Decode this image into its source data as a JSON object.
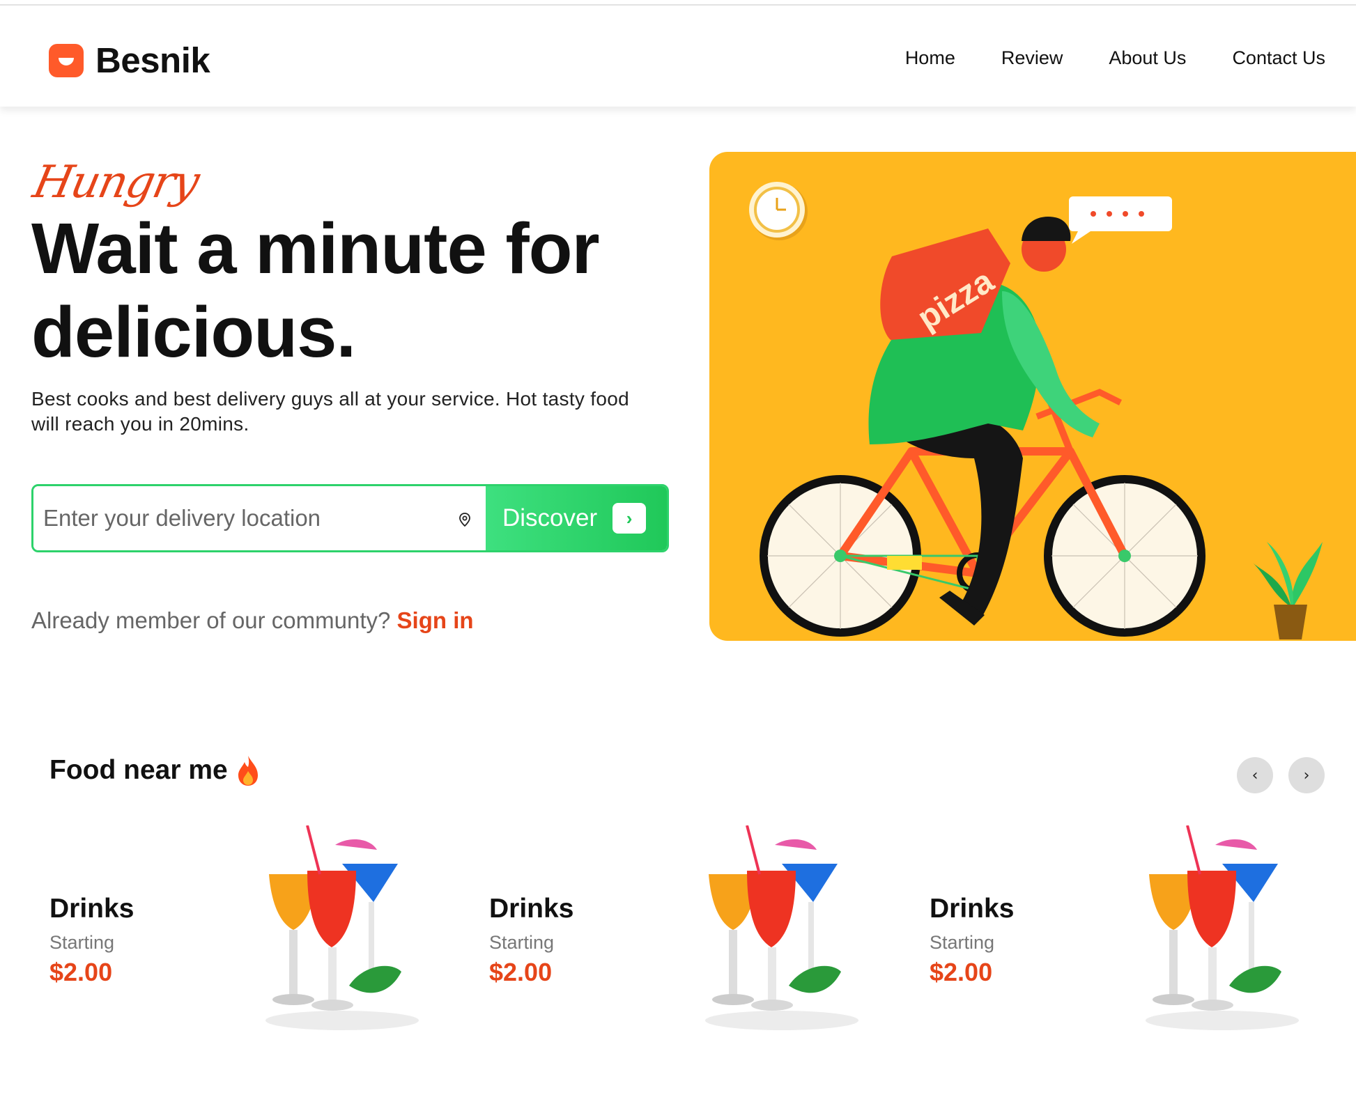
{
  "brand": {
    "name": "Besnik",
    "accent": "#ff5a2a"
  },
  "nav": {
    "items": [
      "Home",
      "Review",
      "About Us",
      "Contact Us"
    ]
  },
  "hero": {
    "eyebrow": "Hungry",
    "title_line1": "Wait a minute for",
    "title_line2": "delicious.",
    "description": "Best cooks and best delivery guys all at your service. Hot tasty food will reach you in 20mins.",
    "search_placeholder": "Enter your delivery location",
    "search_icon": "location-pin-icon",
    "discover_label": "Discover",
    "member_text": "Already member of our communty?",
    "signin_label": "Sign in",
    "illustration_text": "pizza",
    "illustration_bg": "#ffb81f"
  },
  "food": {
    "title": "Food near me",
    "title_icon": "fire-icon",
    "cards": [
      {
        "name": "Drinks",
        "starting": "Starting",
        "price": "$2.00"
      },
      {
        "name": "Drinks",
        "starting": "Starting",
        "price": "$2.00"
      },
      {
        "name": "Drinks",
        "starting": "Starting",
        "price": "$2.00"
      }
    ]
  },
  "colors": {
    "green": "#22c95b",
    "orange": "#e64519"
  }
}
